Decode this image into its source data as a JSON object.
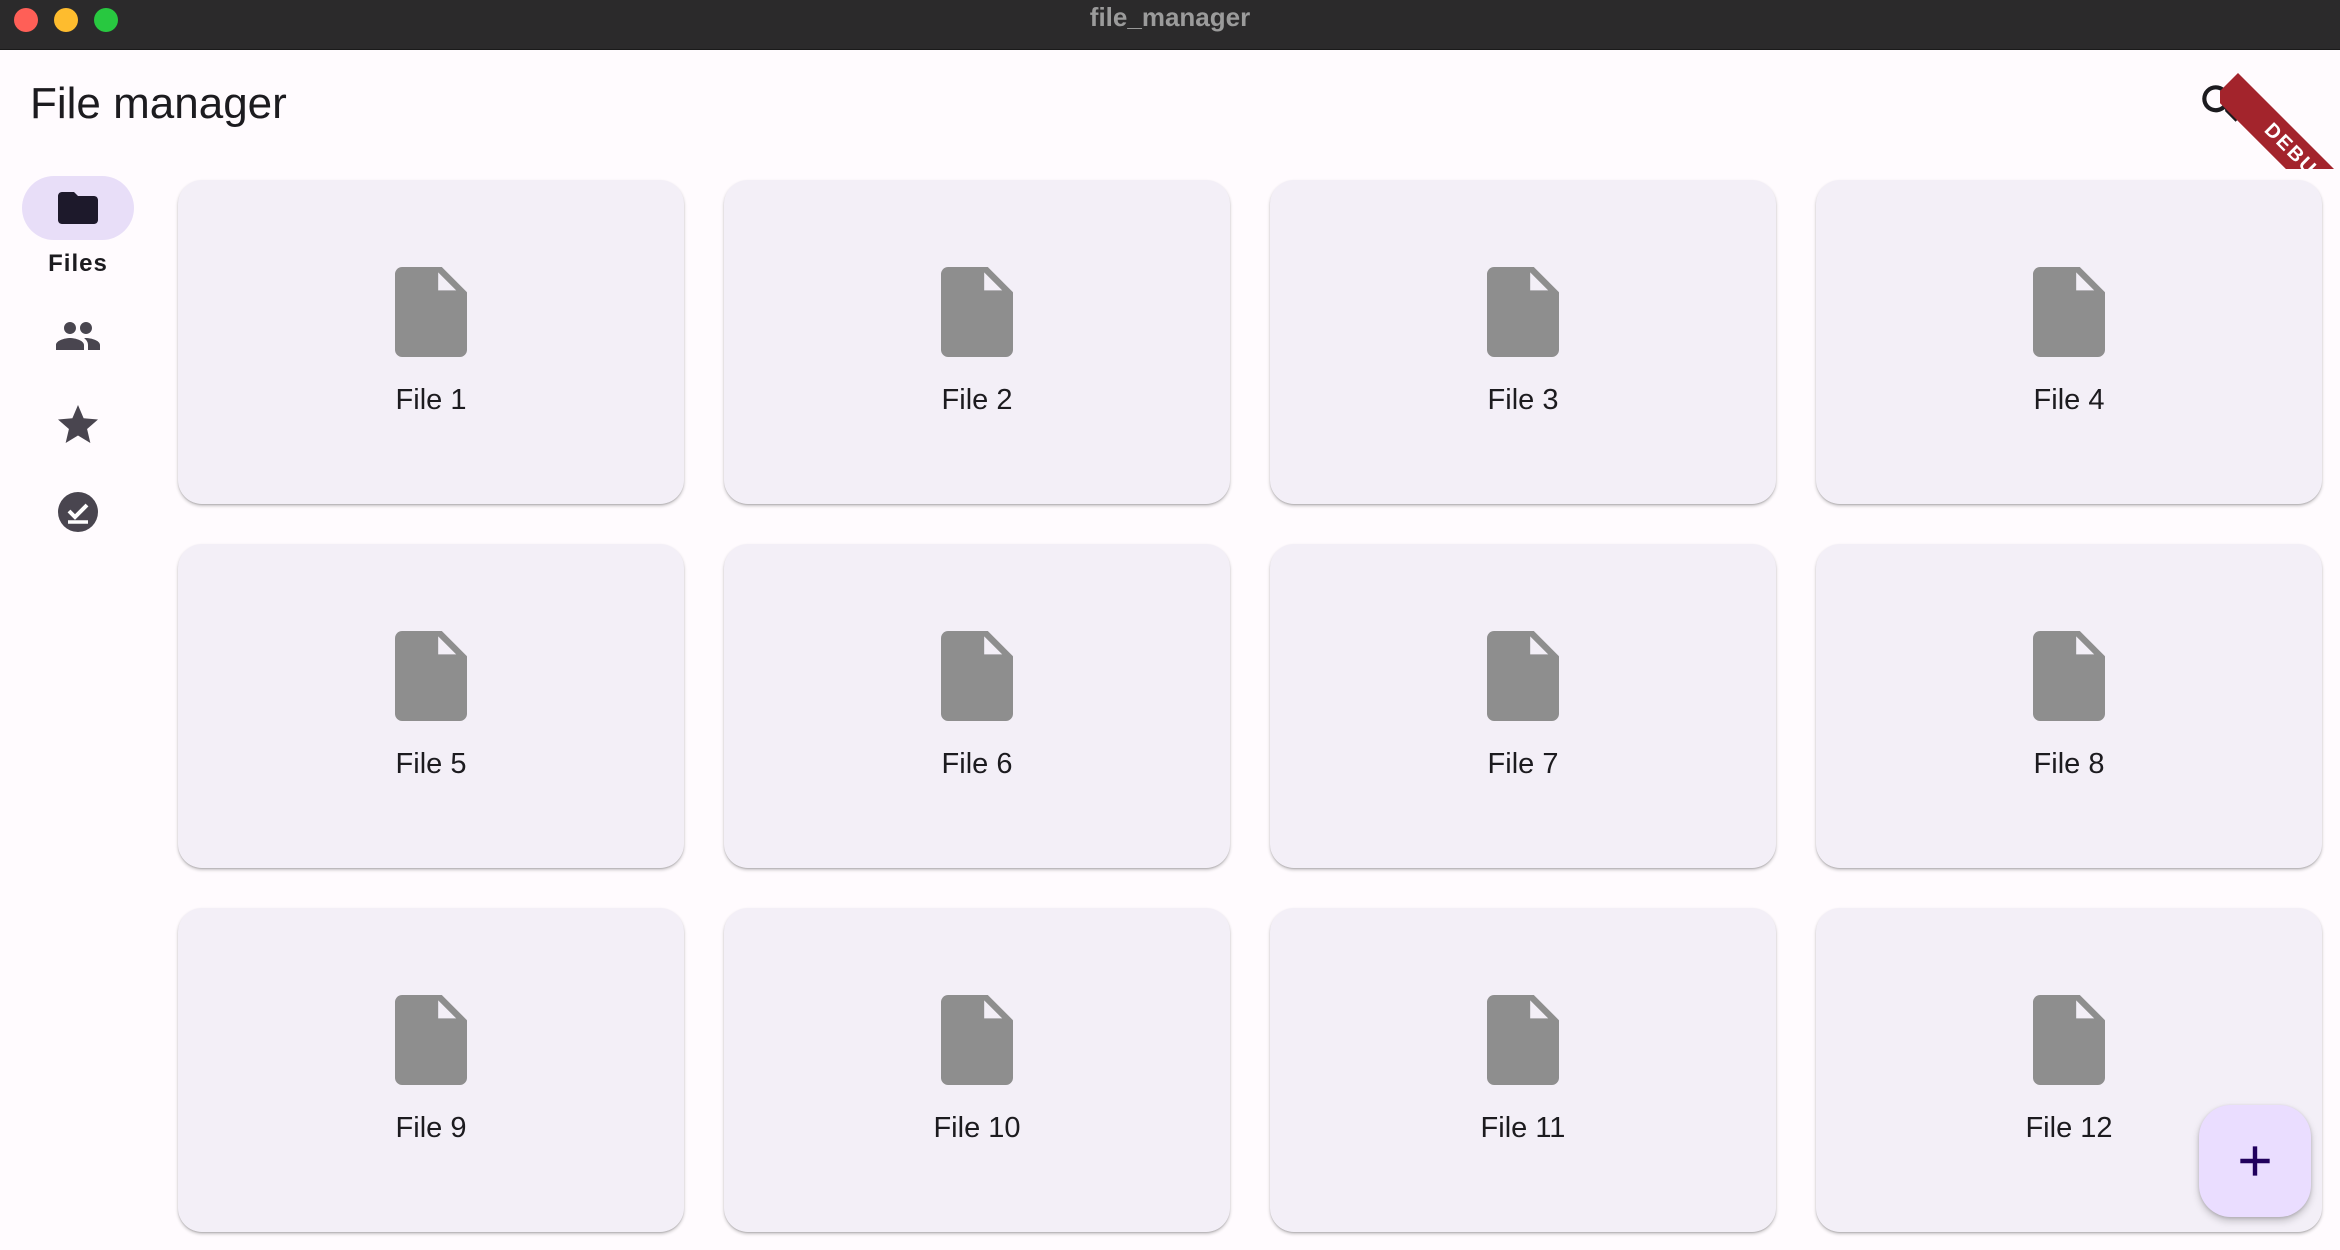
{
  "window": {
    "title": "file_manager"
  },
  "appbar": {
    "title": "File manager",
    "search_icon": "search-icon"
  },
  "debug_banner": "DEBUG",
  "nav_rail": {
    "items": [
      {
        "icon": "folder-icon",
        "label": "Files",
        "selected": true
      },
      {
        "icon": "people-icon",
        "label": "",
        "selected": false
      },
      {
        "icon": "star-icon",
        "label": "",
        "selected": false
      },
      {
        "icon": "check-circle-icon",
        "label": "",
        "selected": false
      }
    ]
  },
  "files": [
    {
      "name": "File 1"
    },
    {
      "name": "File 2"
    },
    {
      "name": "File 3"
    },
    {
      "name": "File 4"
    },
    {
      "name": "File 5"
    },
    {
      "name": "File 6"
    },
    {
      "name": "File 7"
    },
    {
      "name": "File 8"
    },
    {
      "name": "File 9"
    },
    {
      "name": "File 10"
    },
    {
      "name": "File 11"
    },
    {
      "name": "File 12"
    }
  ],
  "fab": {
    "icon": "add-icon"
  },
  "colors": {
    "background": "#fffbfe",
    "card": "#f3eff7",
    "nav_indicator": "#e8def8",
    "fab": "#eaddff",
    "file_icon": "#8e8e8e",
    "debug": "#a3242c"
  }
}
